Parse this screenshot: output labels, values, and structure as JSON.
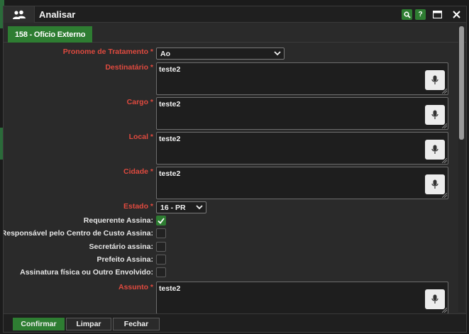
{
  "window": {
    "title": "Analisar",
    "icon": "users-icon",
    "actions": [
      "search-icon",
      "help-icon",
      "maximize-icon",
      "close-icon"
    ],
    "help_label": "?"
  },
  "tab": {
    "label": "158 - Ofício Externo"
  },
  "colors": {
    "accent": "#2e7d32",
    "required": "#e04a3f",
    "background": "#2a2a2a"
  },
  "form": {
    "pronome": {
      "label": "Pronome de Tratamento *",
      "value": "Ao"
    },
    "destinatario": {
      "label": "Destinatário *",
      "value": "teste2"
    },
    "cargo": {
      "label": "Cargo *",
      "value": "teste2"
    },
    "local": {
      "label": "Local *",
      "value": "teste2"
    },
    "cidade": {
      "label": "Cidade *",
      "value": "teste2"
    },
    "estado": {
      "label": "Estado *",
      "value": "16 - PR"
    },
    "requerente": {
      "label": "Requerente Assina:",
      "checked": true
    },
    "responsavel": {
      "label": "Responsável pelo Centro de Custo Assina:",
      "checked": false
    },
    "secretario": {
      "label": "Secretário assina:",
      "checked": false
    },
    "prefeito": {
      "label": "Prefeito Assina:",
      "checked": false
    },
    "assinatura": {
      "label": "Assinatura física ou Outro Envolvido:",
      "checked": false
    },
    "assunto": {
      "label": "Assunto *",
      "value": "teste2"
    }
  },
  "footer": {
    "confirm": "Confirmar",
    "clear": "Limpar",
    "close": "Fechar"
  }
}
